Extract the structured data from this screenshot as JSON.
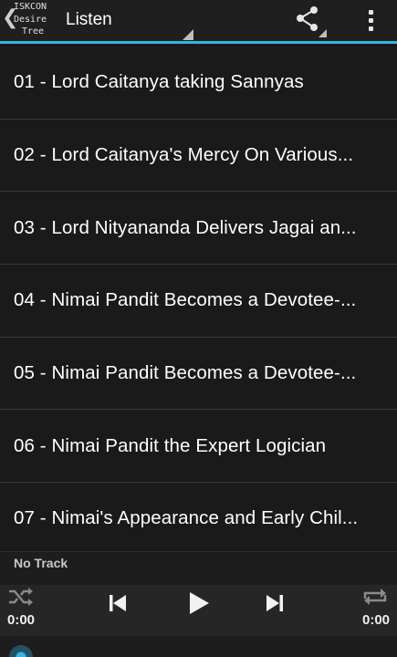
{
  "actionbar": {
    "logo_text": "ISKCON\nDesire\n Tree",
    "up_glyph": "❮",
    "spinner_label": "Listen",
    "share_icon": "share-icon",
    "overflow_icon": "overflow-menu-icon",
    "accent_color": "#33b5e5"
  },
  "tracks": [
    {
      "title": "01 - Lord Caitanya taking Sannyas"
    },
    {
      "title": "02 - Lord Caitanya's Mercy On Various..."
    },
    {
      "title": "03 - Lord Nityananda Delivers Jagai an..."
    },
    {
      "title": "04 - Nimai Pandit Becomes a Devotee-..."
    },
    {
      "title": "05 - Nimai Pandit Becomes a Devotee-..."
    },
    {
      "title": "06 - Nimai Pandit the Expert Logician"
    },
    {
      "title": "07 - Nimai's Appearance and Early Chil..."
    }
  ],
  "player": {
    "now_playing": "No Track",
    "elapsed": "0:00",
    "duration": "0:00",
    "progress": 0,
    "icons": [
      "shuffle-icon",
      "skip-previous-icon",
      "play-icon",
      "skip-next-icon",
      "repeat-icon"
    ]
  }
}
